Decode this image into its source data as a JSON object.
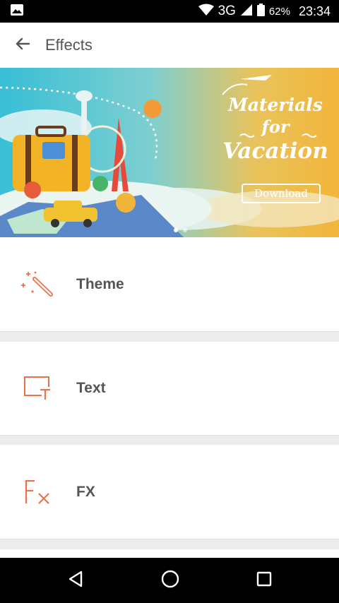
{
  "status_bar": {
    "network": "3G",
    "battery_percent": "62%",
    "time": "23:34",
    "icons": [
      "image-notification-icon",
      "wifi-icon",
      "cell-signal-icon",
      "battery-icon"
    ]
  },
  "app_bar": {
    "title": "Effects",
    "back_icon": "arrow-left-icon"
  },
  "banner": {
    "line1": "Materials",
    "line2": "for",
    "line3": "Vacation",
    "button_label": "Download",
    "page_count": 2,
    "active_page": 1,
    "colors": {
      "sky_left": "#38c0d6",
      "sky_right": "#f2b73a"
    }
  },
  "items": [
    {
      "label": "Theme",
      "icon": "magic-wand-icon"
    },
    {
      "label": "Text",
      "icon": "text-box-icon"
    },
    {
      "label": "FX",
      "icon": "fx-icon"
    }
  ],
  "accent_color": "#e8734a",
  "nav_bar": {
    "icons": [
      "back-triangle-icon",
      "home-circle-icon",
      "recents-square-icon"
    ]
  }
}
